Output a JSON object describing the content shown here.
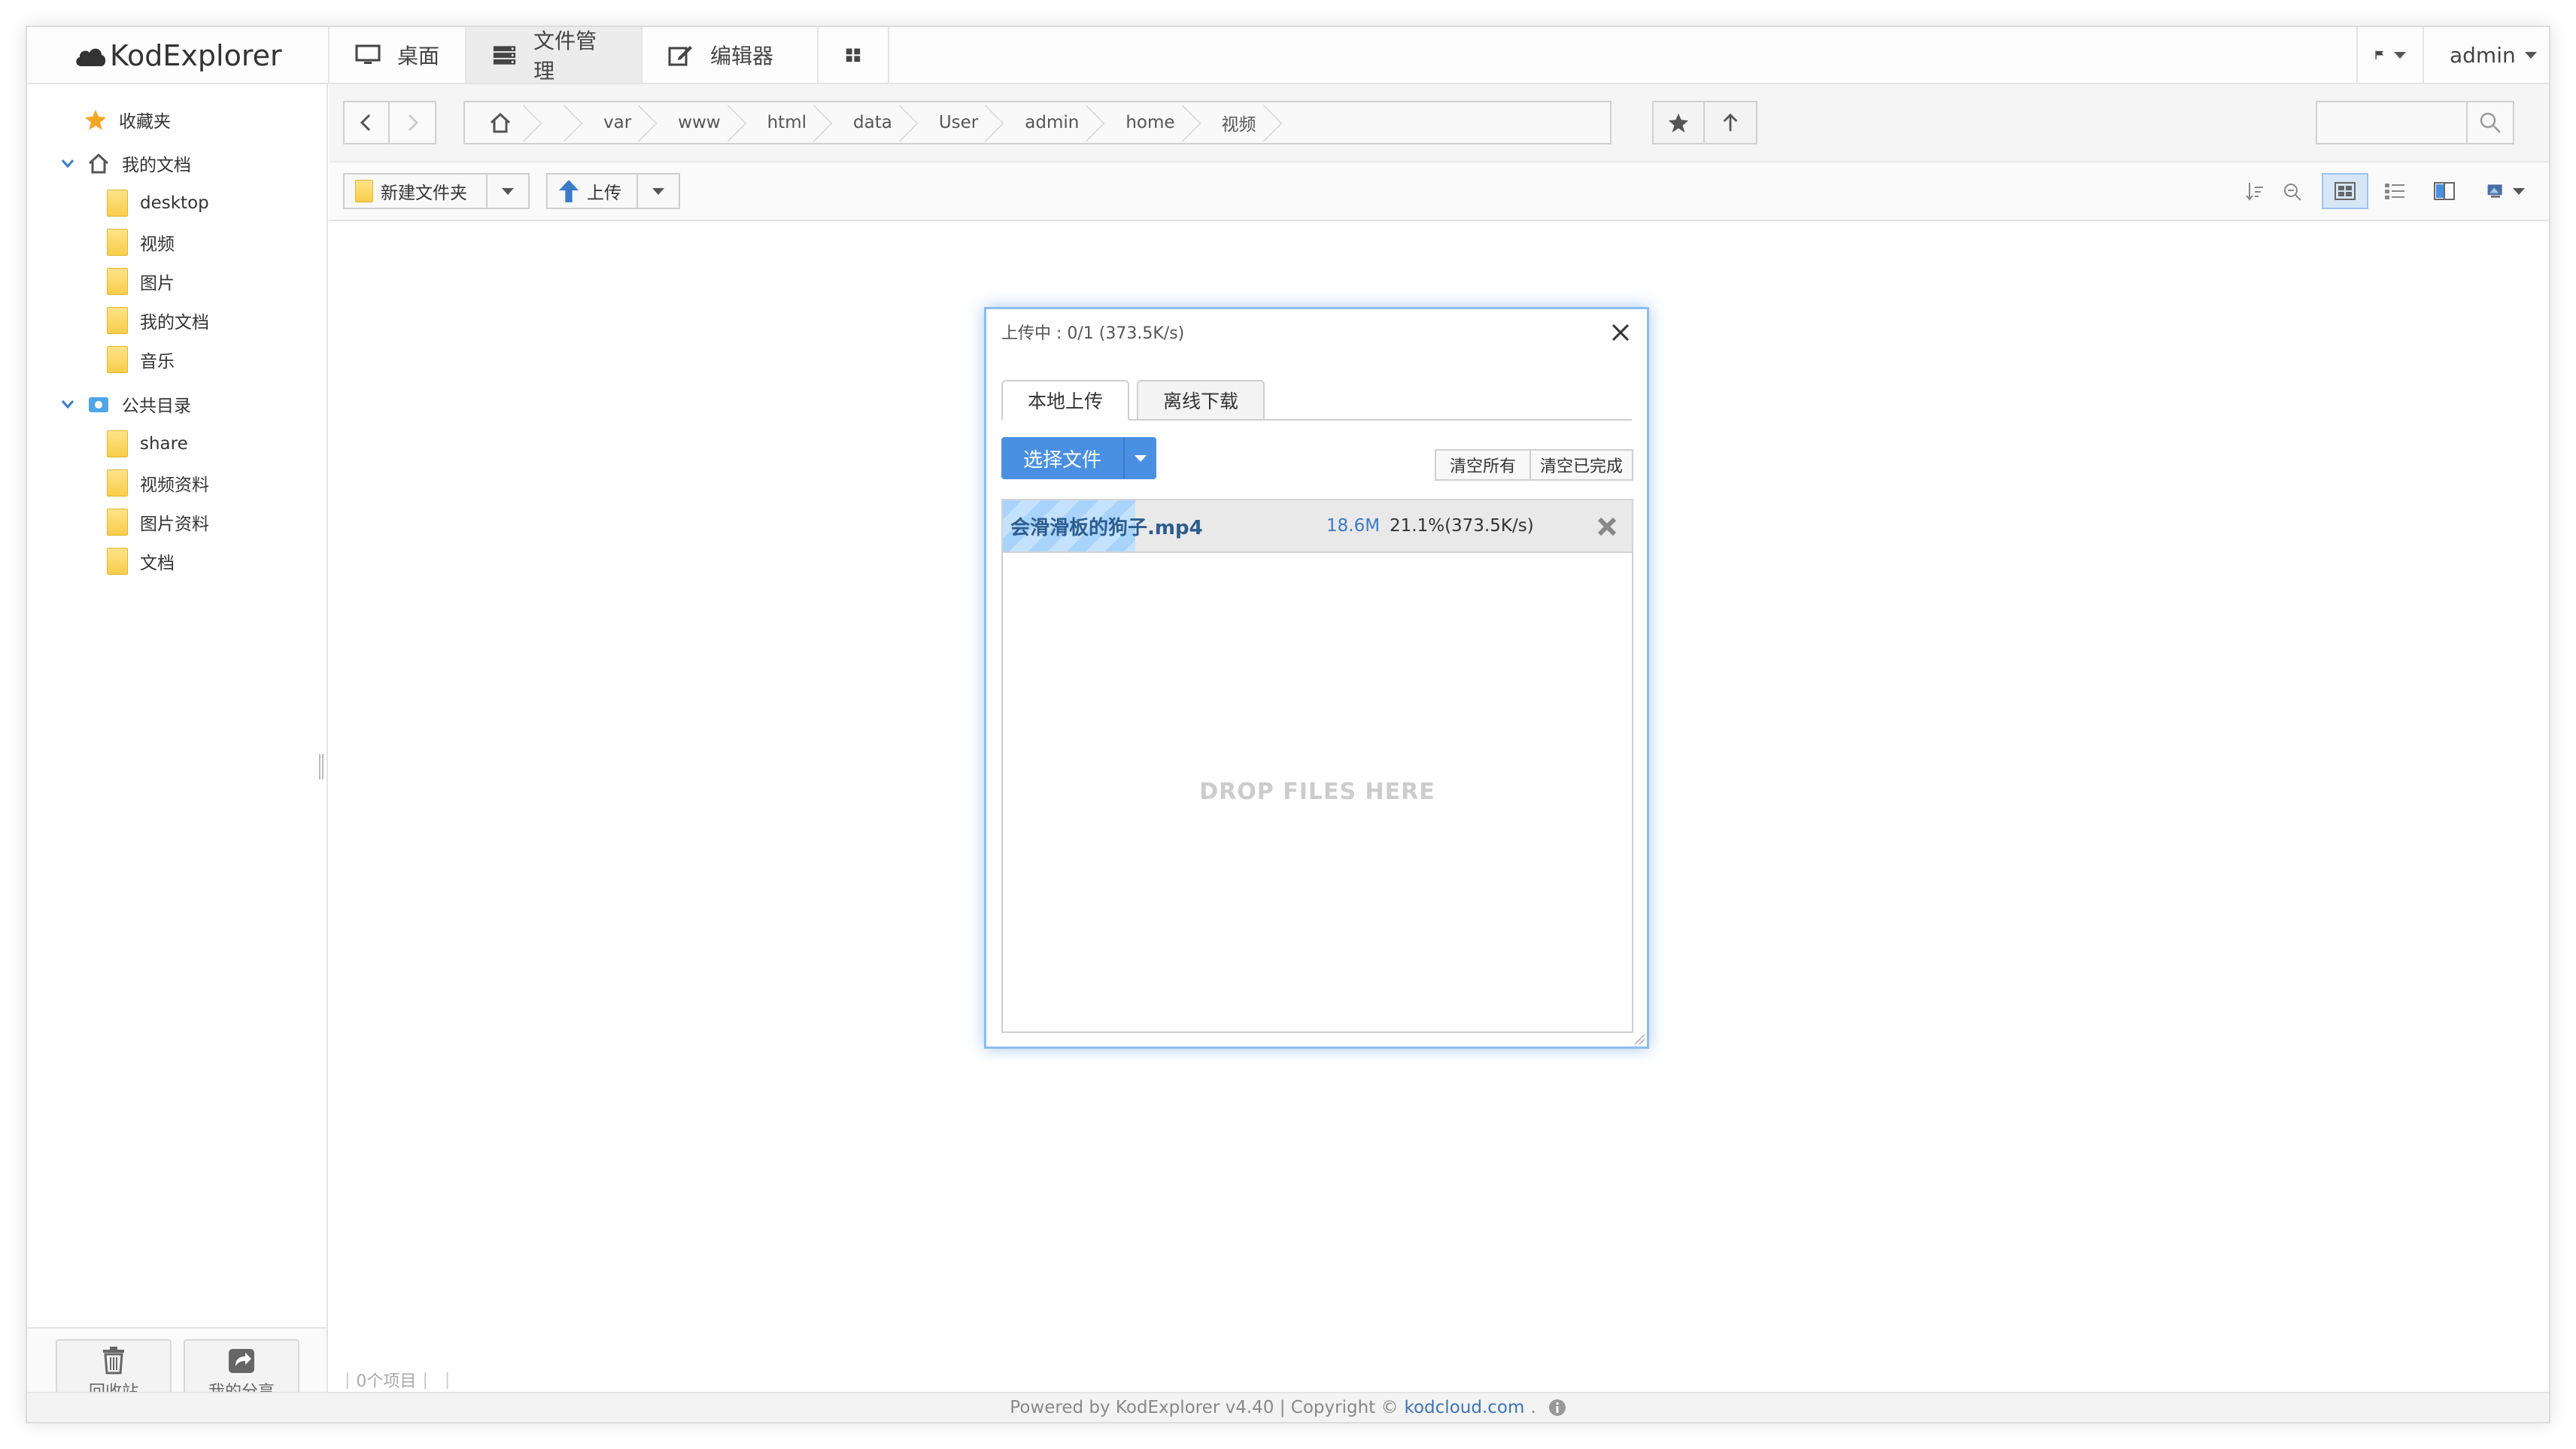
{
  "app": {
    "logo_text": "KodExplorer"
  },
  "nav": {
    "tabs": [
      {
        "label": "桌面",
        "icon": "monitor-icon"
      },
      {
        "label": "文件管理",
        "icon": "server-icon"
      },
      {
        "label": "编辑器",
        "icon": "edit-icon"
      },
      {
        "label": "",
        "icon": "grid-icon"
      }
    ],
    "active_tab": "文件管理",
    "user": "admin"
  },
  "sidebar": {
    "favorites": "收藏夹",
    "my_docs": {
      "label": "我的文档",
      "children": [
        "desktop",
        "视频",
        "图片",
        "我的文档",
        "音乐"
      ]
    },
    "public": {
      "label": "公共目录",
      "children": [
        "share",
        "视频资料",
        "图片资料",
        "文档"
      ]
    },
    "bottom": {
      "recycle": "回收站",
      "my_share": "我的分享"
    }
  },
  "pathbar": {
    "crumbs": [
      "var",
      "www",
      "html",
      "data",
      "User",
      "admin",
      "home",
      "视频"
    ],
    "search_placeholder": ""
  },
  "toolbar": {
    "new_folder": "新建文件夹",
    "upload": "上传"
  },
  "status": {
    "item_count": "0个项目"
  },
  "footer": {
    "prefix": "Powered by KodExplorer v4.40 | Copyright ©",
    "link": "kodcloud.com",
    "suffix": "."
  },
  "dialog": {
    "title": "上传中 : 0/1 (373.5K/s)",
    "tabs": [
      "本地上传",
      "离线下载"
    ],
    "select_files": "选择文件",
    "clear_all": "清空所有",
    "clear_done": "清空已完成",
    "file": {
      "name": "会滑滑板的狗子.mp4",
      "size": "18.6M",
      "progress_text": "21.1%(373.5K/s)",
      "progress": 0.211
    },
    "drop_text": "DROP FILES HERE"
  },
  "colors": {
    "accent": "#4a90e2",
    "progress": "#a8d3fb",
    "dialog_border": "#8bbcf0",
    "link": "#3b73b9"
  }
}
